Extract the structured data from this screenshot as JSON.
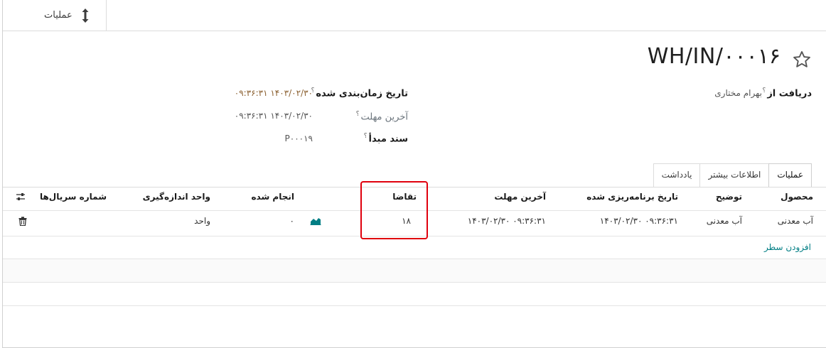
{
  "stat_button": {
    "label": "عملیات",
    "icon": "vertical-arrows-icon"
  },
  "record": {
    "title": "WH/IN/۰۰۰۱۶"
  },
  "fields": {
    "receive_from": {
      "label": "دریافت از",
      "help": "؟",
      "value": "بهرام مختاری"
    },
    "scheduled_date": {
      "label": "تاریخ زمان‌بندی شده",
      "help": "؟",
      "value": "۰۹:۳۶:۳۱ ۱۴۰۳/۰۲/۳۰"
    },
    "deadline": {
      "label": "آخرین مهلت",
      "help": "؟",
      "value": "۰۹:۳۶:۳۱ ۱۴۰۳/۰۲/۳۰"
    },
    "source_document": {
      "label": "سند مبدأ",
      "help": "؟",
      "value": "P۰۰۰۱۹"
    }
  },
  "tabs": [
    {
      "label": "عملیات",
      "active": true
    },
    {
      "label": "اطلاعات بیشتر",
      "active": false
    },
    {
      "label": "یادداشت",
      "active": false
    }
  ],
  "table": {
    "columns": {
      "product": "محصول",
      "description": "توضیح",
      "scheduled": "تاریخ برنامه‌ریزی شده",
      "deadline": "آخرین مهلت",
      "demand": "تقاضا",
      "done": "انجام شده",
      "uom": "واحد اندازه‌گیری",
      "serials": "شماره سریال‌ها"
    },
    "rows": [
      {
        "product": "آب معدنی",
        "description": "آب معدنی",
        "scheduled": "۰۹:۳۶:۳۱ ۱۴۰۳/۰۲/۳۰",
        "deadline": "۰۹:۳۶:۳۱ ۱۴۰۳/۰۲/۳۰",
        "demand": "۱۸",
        "done": "۰",
        "uom": "واحد"
      }
    ],
    "add_line": "افزودن سطر"
  },
  "colors": {
    "accent": "#017e84",
    "highlight": "#e0000d",
    "brown_value": "#8b6030"
  }
}
